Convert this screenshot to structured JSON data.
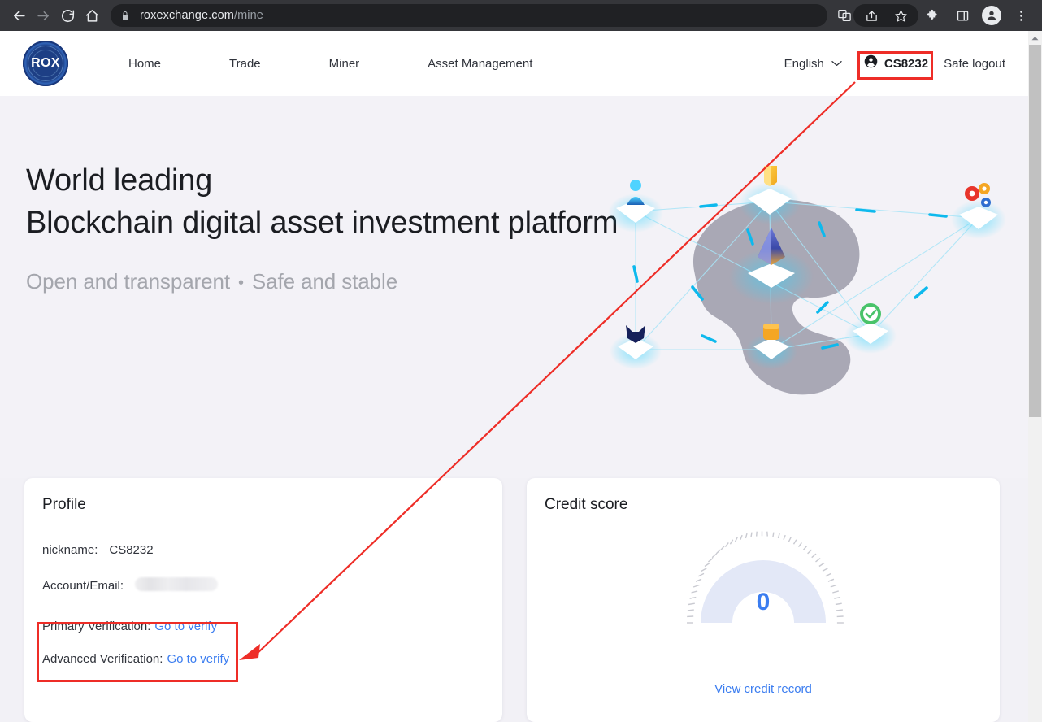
{
  "browser": {
    "back_icon": "arrow-left-icon",
    "forward_icon": "arrow-right-icon",
    "reload_icon": "reload-icon",
    "home_icon": "home-icon",
    "lock_icon": "lock-icon",
    "url_domain": "roxexchange.com",
    "url_path": "/mine",
    "translate_icon": "translate-icon",
    "share_icon": "share-icon",
    "bookmark_icon": "star-icon",
    "extensions_icon": "puzzle-piece-icon",
    "sidepanel_icon": "side-panel-icon",
    "profile_icon": "user-avatar-icon",
    "menu_icon": "three-dot-menu-icon"
  },
  "header": {
    "logo_text": "ROX",
    "nav": [
      {
        "label": "Home"
      },
      {
        "label": "Trade"
      },
      {
        "label": "Miner"
      },
      {
        "label": "Asset Management"
      }
    ],
    "language": "English",
    "language_chevron": "chevron-down-icon",
    "user_icon": "user-circle-icon",
    "username": "CS8232",
    "logout_label": "Safe logout"
  },
  "hero": {
    "title_line1": "World leading",
    "title_line2": "Blockchain digital asset investment platform",
    "sub_left": "Open and transparent",
    "sub_dot": "•",
    "sub_right": "Safe and stable"
  },
  "profile": {
    "title": "Profile",
    "nickname_label": "nickname:",
    "nickname_value": "CS8232",
    "email_label": "Account/Email:",
    "email_value": "",
    "primary_label": "Primary Verification:",
    "primary_link": "Go to verify",
    "advanced_label": "Advanced Verification:",
    "advanced_link": "Go to verify"
  },
  "credit": {
    "title": "Credit score",
    "score": "0",
    "link": "View credit record"
  },
  "annotations": {
    "highlight_color": "#ee2d27",
    "boxes": [
      "username-chip",
      "verification-rows"
    ],
    "arrow": "red-arrow-pointing-to-verification"
  },
  "colors": {
    "accent_blue": "#3b7df0",
    "logo_blue": "#1d3f85",
    "hero_bg": "#f3f2f7",
    "page_bg": "#f2f1f6",
    "chrome_bg": "#35363a"
  },
  "scrollbar": {
    "up_arrow_icon": "scroll-up-arrow-icon"
  }
}
